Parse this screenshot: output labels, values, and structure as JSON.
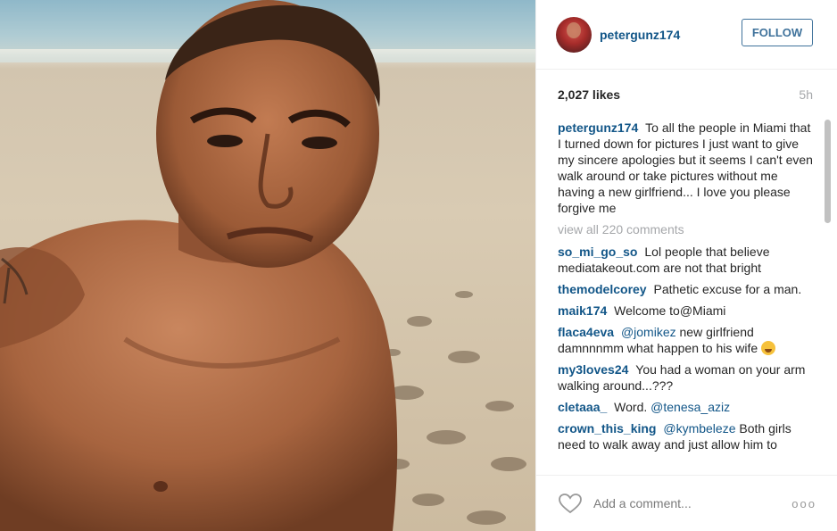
{
  "post": {
    "username": "petergunz174",
    "follow_label": "FOLLOW",
    "likes": "2,027 likes",
    "time": "5h"
  },
  "caption": {
    "user": "petergunz174",
    "text": "To all the people in Miami that I turned down for pictures I just want to give my sincere apologies but it seems I can't even walk around or take pictures without me having a new girlfriend... I love you please forgive me"
  },
  "view_all": "view all 220 comments",
  "comments": [
    {
      "user": "so_mi_go_so",
      "text": "Lol people that believe mediatakeout.com are not that bright"
    },
    {
      "user": "themodelcorey",
      "text": "Pathetic excuse for a man."
    },
    {
      "user": "maik174",
      "text": "Welcome to@Miami"
    },
    {
      "user": "flaca4eva",
      "mention": "@jomikez",
      "text": "new girlfriend damnnnmm what happen to his wife"
    },
    {
      "user": "my3loves24",
      "text": "You had a woman on your arm walking around...???"
    },
    {
      "user": "cletaaa_",
      "text": "Word.",
      "mention": "@tenesa_aziz"
    },
    {
      "user": "crown_this_king",
      "mention": "@kymbeleze",
      "text": "Both girls need to walk away and just allow him to"
    }
  ],
  "footer": {
    "placeholder": "Add a comment...",
    "more": "ooo"
  },
  "icons": {
    "heart": "heart-icon",
    "more": "more-options-icon",
    "emoji": "laughing-emoji-icon"
  },
  "colors": {
    "link": "#125688",
    "follow": "#3f729b",
    "muted": "#a5a7aa"
  }
}
